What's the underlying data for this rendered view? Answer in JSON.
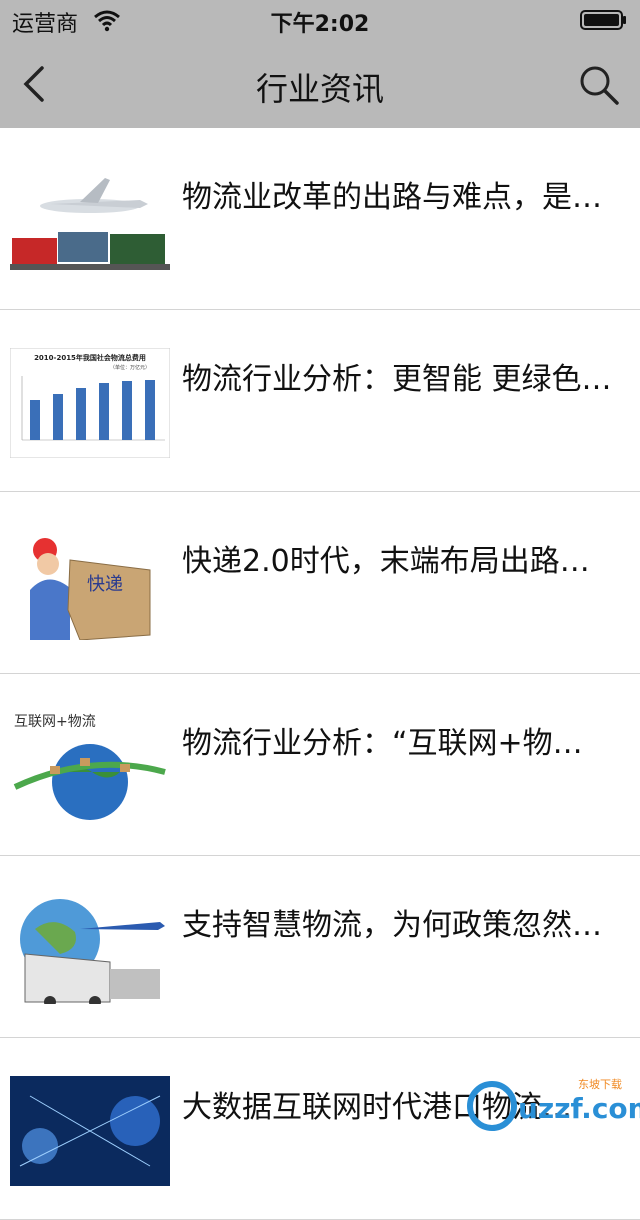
{
  "status_bar": {
    "carrier": "运营商",
    "time": "下午2:02"
  },
  "nav": {
    "title": "行业资讯",
    "back_icon": "chevron-left-icon",
    "search_icon": "search-icon"
  },
  "articles": [
    {
      "title": "物流业改革的出路与难点，是…",
      "thumb": "plane-truck-ship"
    },
    {
      "title": "物流行业分析：更智能 更绿色…",
      "thumb": "bar-chart",
      "thumb_chart_title": "2010-2015年我国社会物流总费用",
      "thumb_chart_unit": "（单位：万亿元）"
    },
    {
      "title": "快递2.0时代，末端布局出路…",
      "thumb": "courier-box",
      "thumb_box_text": "快递"
    },
    {
      "title": "物流行业分析：“互联网+物…",
      "thumb": "globe-boxes",
      "thumb_caption": "互联网+物流"
    },
    {
      "title": "支持智慧物流，为何政策忽然…",
      "thumb": "globe-plane-truck"
    },
    {
      "title": "大数据互联网时代港口物流…",
      "thumb": "network"
    }
  ],
  "watermark": {
    "text": "uzzf.com",
    "subtext": "东坡下载"
  }
}
